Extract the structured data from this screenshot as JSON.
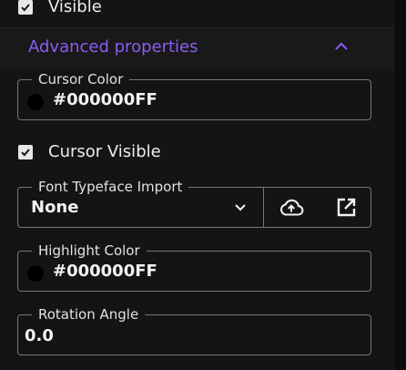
{
  "visible": {
    "label": "Visible",
    "checked": true
  },
  "advanced": {
    "title": "Advanced properties",
    "expanded": true,
    "accent_color": "#8b5cf6"
  },
  "cursor_color": {
    "label": "Cursor Color",
    "value": "#000000FF",
    "swatch_color": "#000000"
  },
  "cursor_visible": {
    "label": "Cursor Visible",
    "checked": true
  },
  "font_typeface_import": {
    "label": "Font Typeface Import",
    "value": "None",
    "icons": [
      "cloud-upload-icon",
      "open-in-new-icon"
    ]
  },
  "highlight_color": {
    "label": "Highlight Color",
    "value": "#000000FF",
    "swatch_color": "#000000"
  },
  "rotation_angle": {
    "label": "Rotation Angle",
    "value": "0.0"
  }
}
